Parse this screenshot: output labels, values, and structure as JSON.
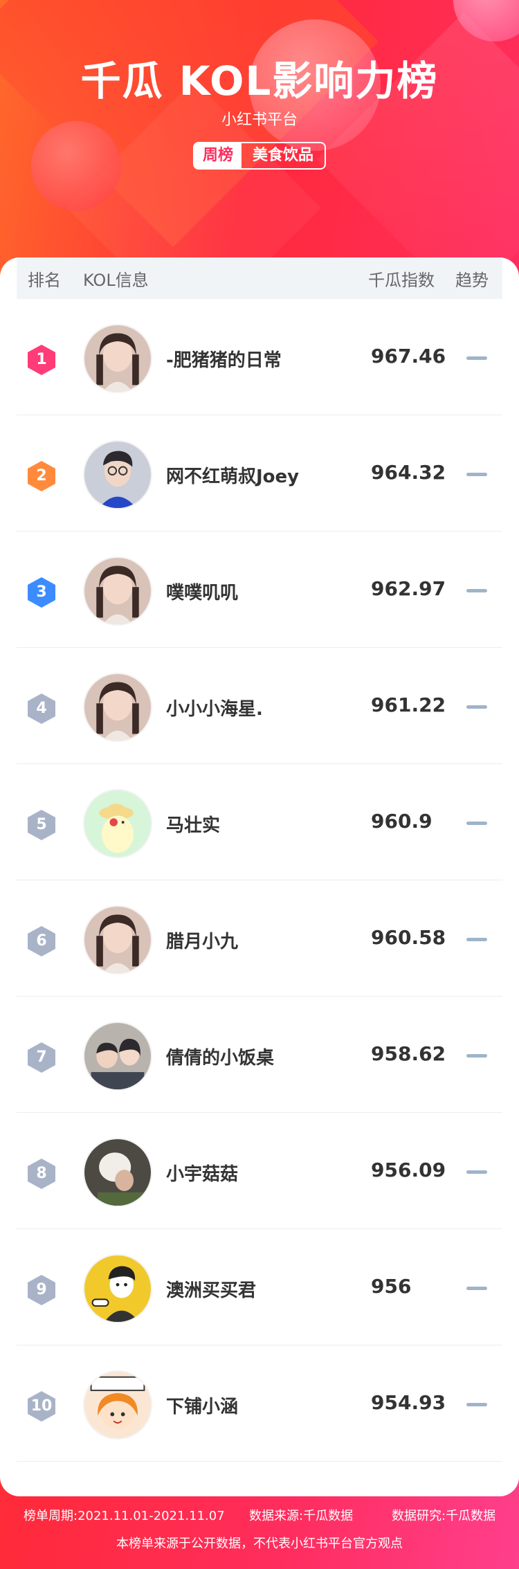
{
  "header": {
    "title": "千瓜 KOL影响力榜",
    "subtitle": "小红书平台",
    "tag_period": "周榜",
    "tag_category": "美食饮品"
  },
  "table": {
    "columns": {
      "rank": "排名",
      "info": "KOL信息",
      "score": "千瓜指数",
      "trend": "趋势"
    },
    "rows": [
      {
        "rank": "1",
        "name": "-肥猪猪的日常",
        "score": "967.46",
        "badge_color": "#ff3c78",
        "avatar_icon": "woman-portrait"
      },
      {
        "rank": "2",
        "name": "网不红萌叔Joey",
        "score": "964.32",
        "badge_color": "#ff8a3c",
        "avatar_icon": "man-portrait"
      },
      {
        "rank": "3",
        "name": "噗噗叽叽",
        "score": "962.97",
        "badge_color": "#3c8cff",
        "avatar_icon": "woman-portrait"
      },
      {
        "rank": "4",
        "name": "小小小海星.",
        "score": "961.22",
        "badge_color": "#a9b3c8",
        "avatar_icon": "woman-portrait"
      },
      {
        "rank": "5",
        "name": "马壮实",
        "score": "960.9",
        "badge_color": "#a9b3c8",
        "avatar_icon": "cartoon-bird"
      },
      {
        "rank": "6",
        "name": "腊月小九",
        "score": "960.58",
        "badge_color": "#a9b3c8",
        "avatar_icon": "woman-portrait"
      },
      {
        "rank": "7",
        "name": "倩倩的小饭桌",
        "score": "958.62",
        "badge_color": "#a9b3c8",
        "avatar_icon": "family-portrait"
      },
      {
        "rank": "8",
        "name": "小宇菇菇",
        "score": "956.09",
        "badge_color": "#a9b3c8",
        "avatar_icon": "person-portrait"
      },
      {
        "rank": "9",
        "name": "澳洲买买君",
        "score": "956",
        "badge_color": "#a9b3c8",
        "avatar_icon": "cartoon-man"
      },
      {
        "rank": "10",
        "name": "下铺小涵",
        "score": "954.93",
        "badge_color": "#a9b3c8",
        "avatar_icon": "cartoon-girl"
      }
    ]
  },
  "footer": {
    "period": "榜单周期:2021.11.01-2021.11.07",
    "source": "数据来源:千瓜数据",
    "research": "数据研究:千瓜数据",
    "disclaimer": "本榜单来源于公开数据，不代表小红书平台官方观点"
  }
}
